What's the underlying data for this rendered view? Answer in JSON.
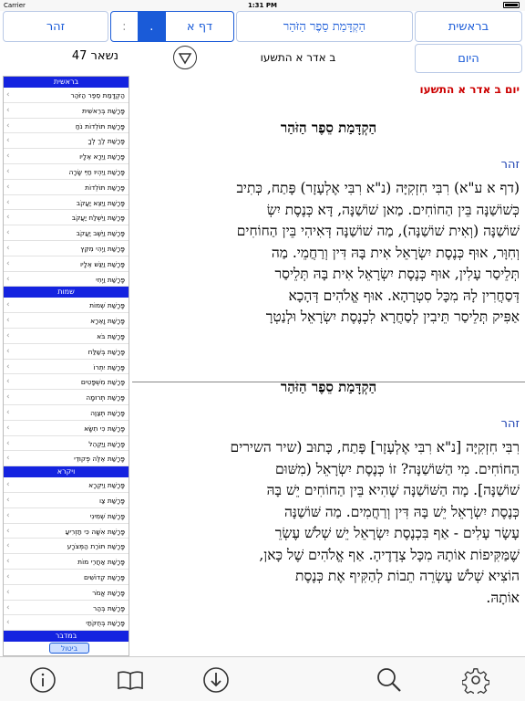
{
  "status": {
    "carrier": "Carrier",
    "time": "1:31 PM"
  },
  "toolbar": {
    "bereishit": "בראשית",
    "intro": "הַקְדָּמַת סֵפֶר הַזֹּהַר",
    "daf": "דף א",
    "seg_small": ":",
    "seg_active": ".",
    "zohar": "זהר",
    "today": "היום",
    "remaining": "נשאר 47",
    "date": "ב אדר א התשעו"
  },
  "sidebar": {
    "sections": [
      {
        "title": "בראשית",
        "items": [
          "הַקְדָּמַת סֵפֶר הַזֹּהַר",
          "פָּרָשַׁת בְּרֵאשִׁית",
          "פָּרָשַׁת תּוֹלְדוֹת נֹחַ",
          "פָּרָשַׁת לֶךְ לְךָ",
          "פָּרָשַׁת וַיֵּרָא אֵלָיו",
          "פָּרָשַׁת וַיִּהְיוּ חַיֵּי שָׂרָה",
          "פָּרָשַׁת תּוֹלְדוֹת",
          "פָּרָשַׁת וַיֵּצֵא יַעֲקֹב",
          "פָּרָשַׁת וַיִּשְׁלַח יַעֲקֹב",
          "פָּרָשַׁת וַיֵּשֶׁב יַעֲקֹב",
          "פָּרָשַׁת וַיְהִי מִקֵּץ",
          "פָּרָשַׁת וַיִּגַּשׁ אֵלָיו",
          "פָּרָשַׁת וַיְחִי"
        ]
      },
      {
        "title": "שמות",
        "items": [
          "פָּרָשַׁת שְׁמוֹת",
          "פָּרָשַׁת וָאֵרָא",
          "פָּרָשַׁת בֹּא",
          "פָּרָשַׁת בְּשַׁלַּח",
          "פָּרָשַׁת יִתְרוֹ",
          "פָּרָשַׁת מִשְׁפָּטִים",
          "פָּרָשַׁת תְּרוּמָה",
          "פָּרָשַׁת תְּצַוֶּה",
          "פָּרָשַׁת כִּי תִשָּׂא",
          "פָּרָשַׁת וַיַּקְהֵל",
          "פָּרָשַׁת אֵלֶּה פְקוּדֵי"
        ]
      },
      {
        "title": "ויקרא",
        "items": [
          "פָּרָשַׁת וַיִּקְרָא",
          "פָּרָשַׁת צַו",
          "פָּרָשַׁת שְׁמִינִי",
          "פָּרָשַׁת אִשָּׁה כִּי תַזְרִיעַ",
          "פָּרָשַׁת תּוֹרַת הַמְּצֹרָע",
          "פָּרָשַׁת אַחֲרֵי מוֹת",
          "פָּרָשַׁת קְדוֹשִׁים",
          "פָּרָשַׁת אֱמֹר",
          "פָּרָשַׁת בְּהַר",
          "פָּרָשַׁת בְּחֻקֹּתַי"
        ]
      }
    ],
    "bottom_header": "במדבר",
    "cancel": "ביטול"
  },
  "content": {
    "dayline": "יום ב אדר א התשעו",
    "title1": "הַקְדָּמַת סֵפֶר הַזֹּהַר",
    "zohar_label1": "זהר",
    "text1": [
      "(דף א ע\"א) רִבִּי חִזְקִיָּה (נ\"א רִבִּי אֶלְעָזָר) פָּתַח, כְּתִיב",
      "כְּשׁוֹשַׁנָּה בֵּין הַחוֹחִים. מַאן שׁוֹשַׁנָּה, דָּא כְּנֶסֶת יִשְׂ",
      "שׁוֹשַׁנָּה (וְאִית שׁוֹשַׁנָּה), מַה שׁוֹשַׁנָּה דְּאִיהִי בֵּין הַחוֹחִים",
      "וְחִוָּר, אוּף כְּנֶסֶת יִשְׂרָאֵל אִית בָּהּ דִּין וְרַחֲמֵי. מַה",
      "תְּלֵיסַר עָלִין, אוּף כְּנֶסֶת יִשְׂרָאֵל אִית בָּהּ תְּלֵיסַר",
      "דְּסַחֲרִין לָהּ מִכָּל סִטְרָהָא. אוּף אֱלֹהִים דְּהָכָא",
      "אַפִּיק תְּלֵיסַר תֵּיבִין לְסַחֲרָא לִכְנֶסֶת יִשְׂרָאֵל וּלְנַטְרָ"
    ],
    "title2": "הַקְדָּמַת סֵפֶר הַזֹּהַר",
    "zohar_label2": "זהר",
    "text2": [
      "רִבִּי חִזְקִיָּה [נ\"א רִבִּי אֶלְעָזָר] פָּתַח, כָּתוּב (שיר השירים",
      "הַחוֹחִים. מִי הַשּׁוֹשַׁנָּה? זוֹ כְּנֶסֶת יִשְׂרָאֵל (מִשּׁוּם",
      "שׁוֹשַׁנָּה]. מָה הַשּׁוֹשַׁנָּה שֶׁהִיא בֵּין הַחוֹחִים יֵשׁ בָּהּ",
      "כְּנֶסֶת יִשְׂרָאֵל יֵשׁ בָּהּ דִּין וְרַחֲמִים. מַה שּׁוֹשַׁנָּה",
      "עָשָׂר עָלִים - אַף בִּכְנֶסֶת יִשְׂרָאֵל יֵשׁ שְׁלֹשׁ עֶשְׂרֵ",
      "שֶׁמַּקִּיפוֹת אוֹתָהּ מִכָּל צְדָדֶיהָ. אַף אֱלֹהִים שֶׁל כָּאן,",
      "הוֹצִיא שְׁלֹשׁ עֶשְׂרֵה תֵבוֹת לְהַקִּיף אֶת כְּנֶסֶת",
      "אוֹתָהּ."
    ]
  },
  "tabs": [
    "info-icon",
    "book-icon",
    "download-icon",
    "search-icon",
    "gear-icon"
  ],
  "colors": {
    "accent": "#1a5bd8",
    "section": "#1423e0",
    "date_red": "#cc0000"
  }
}
